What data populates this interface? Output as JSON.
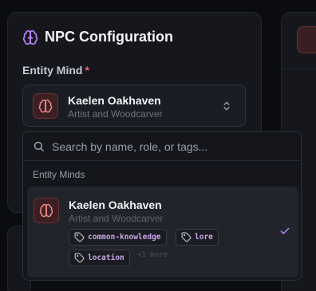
{
  "panel": {
    "title": "NPC Configuration",
    "title_icon": "brain-icon",
    "accent_color": "#c084fc"
  },
  "field": {
    "label": "Entity Mind",
    "required_marker": "*"
  },
  "selected": {
    "name": "Kaelen Oakhaven",
    "role": "Artist and Woodcarver",
    "icon": "brain-icon"
  },
  "dropdown": {
    "search_placeholder": "Search by name, role, or tags...",
    "search_value": "",
    "group_label": "Entity Minds",
    "options": [
      {
        "name": "Kaelen Oakhaven",
        "role": "Artist and Woodcarver",
        "tags": [
          "common-knowledge",
          "lore",
          "location"
        ],
        "more": "+1 more",
        "selected": true
      }
    ]
  },
  "colors": {
    "background": "#0b0c10",
    "panel": "#15171d",
    "avatar_bg": "#3b1f23",
    "avatar_icon": "#f08a8a",
    "tag_text": "#c9a7e6",
    "required": "#e66a6a"
  }
}
